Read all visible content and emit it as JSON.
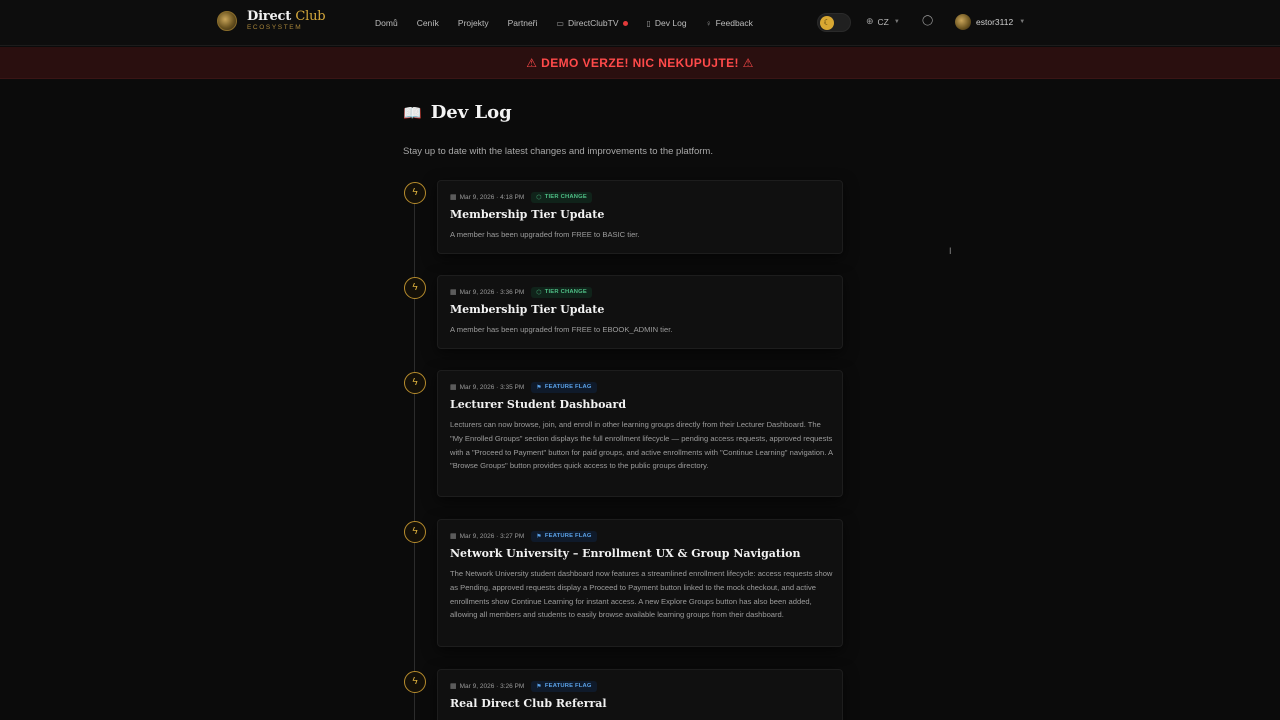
{
  "header": {
    "logo_title_main": "Direct",
    "logo_title_accent": "Club",
    "logo_subtitle": "ECOSYSTEM",
    "nav": [
      {
        "label": "Domů"
      },
      {
        "label": "Ceník"
      },
      {
        "label": "Projekty"
      },
      {
        "label": "Partneři"
      },
      {
        "label": "DirectClubTV",
        "icon": "tv-icon",
        "live": true
      },
      {
        "label": "Dev Log",
        "icon": "book-icon"
      },
      {
        "label": "Feedback",
        "icon": "lightbulb-icon"
      }
    ],
    "language": "CZ",
    "username": "estor3112"
  },
  "banner": {
    "text": "⚠ DEMO VERZE! NIC NEKUPUJTE! ⚠"
  },
  "page": {
    "title": "Dev Log",
    "subtitle": "Stay up to date with the latest changes and improvements to the platform."
  },
  "entries": [
    {
      "date": "Mar 9, 2026 · 4:18 PM",
      "badge": "TIER CHANGE",
      "badge_type": "tier",
      "title": "Membership Tier Update",
      "description": "A member has been upgraded from FREE to BASIC tier."
    },
    {
      "date": "Mar 9, 2026 · 3:36 PM",
      "badge": "TIER CHANGE",
      "badge_type": "tier",
      "title": "Membership Tier Update",
      "description": "A member has been upgraded from FREE to EBOOK_ADMIN tier."
    },
    {
      "date": "Mar 9, 2026 · 3:35 PM",
      "badge": "FEATURE FLAG",
      "badge_type": "flag",
      "title": "Lecturer Student Dashboard",
      "description": "Lecturers can now browse, join, and enroll in other learning groups directly from their Lecturer Dashboard. The \"My Enrolled Groups\" section displays the full enrollment lifecycle — pending access requests, approved requests with a \"Proceed to Payment\" button for paid groups, and active enrollments with \"Continue Learning\" navigation. A \"Browse Groups\" button provides quick access to the public groups directory."
    },
    {
      "date": "Mar 9, 2026 · 3:27 PM",
      "badge": "FEATURE FLAG",
      "badge_type": "flag",
      "title": "Network University – Enrollment UX & Group Navigation",
      "description": "The Network University student dashboard now features a streamlined enrollment lifecycle: access requests show as Pending, approved requests display a Proceed to Payment button linked to the mock checkout, and active enrollments show Continue Learning for instant access. A new Explore Groups button has also been added, allowing all members and students to easily browse available learning groups from their dashboard."
    },
    {
      "date": "Mar 9, 2026 · 3:26 PM",
      "badge": "FEATURE FLAG",
      "badge_type": "flag",
      "title": "Real Direct Club Referral",
      "description": ""
    }
  ],
  "colors": {
    "background": "#0b0b0b",
    "accent_gold": "#d6a93c",
    "demo_red": "#ff4a4a",
    "tier_badge": "#4fbf86",
    "flag_badge": "#5aa0e6"
  }
}
